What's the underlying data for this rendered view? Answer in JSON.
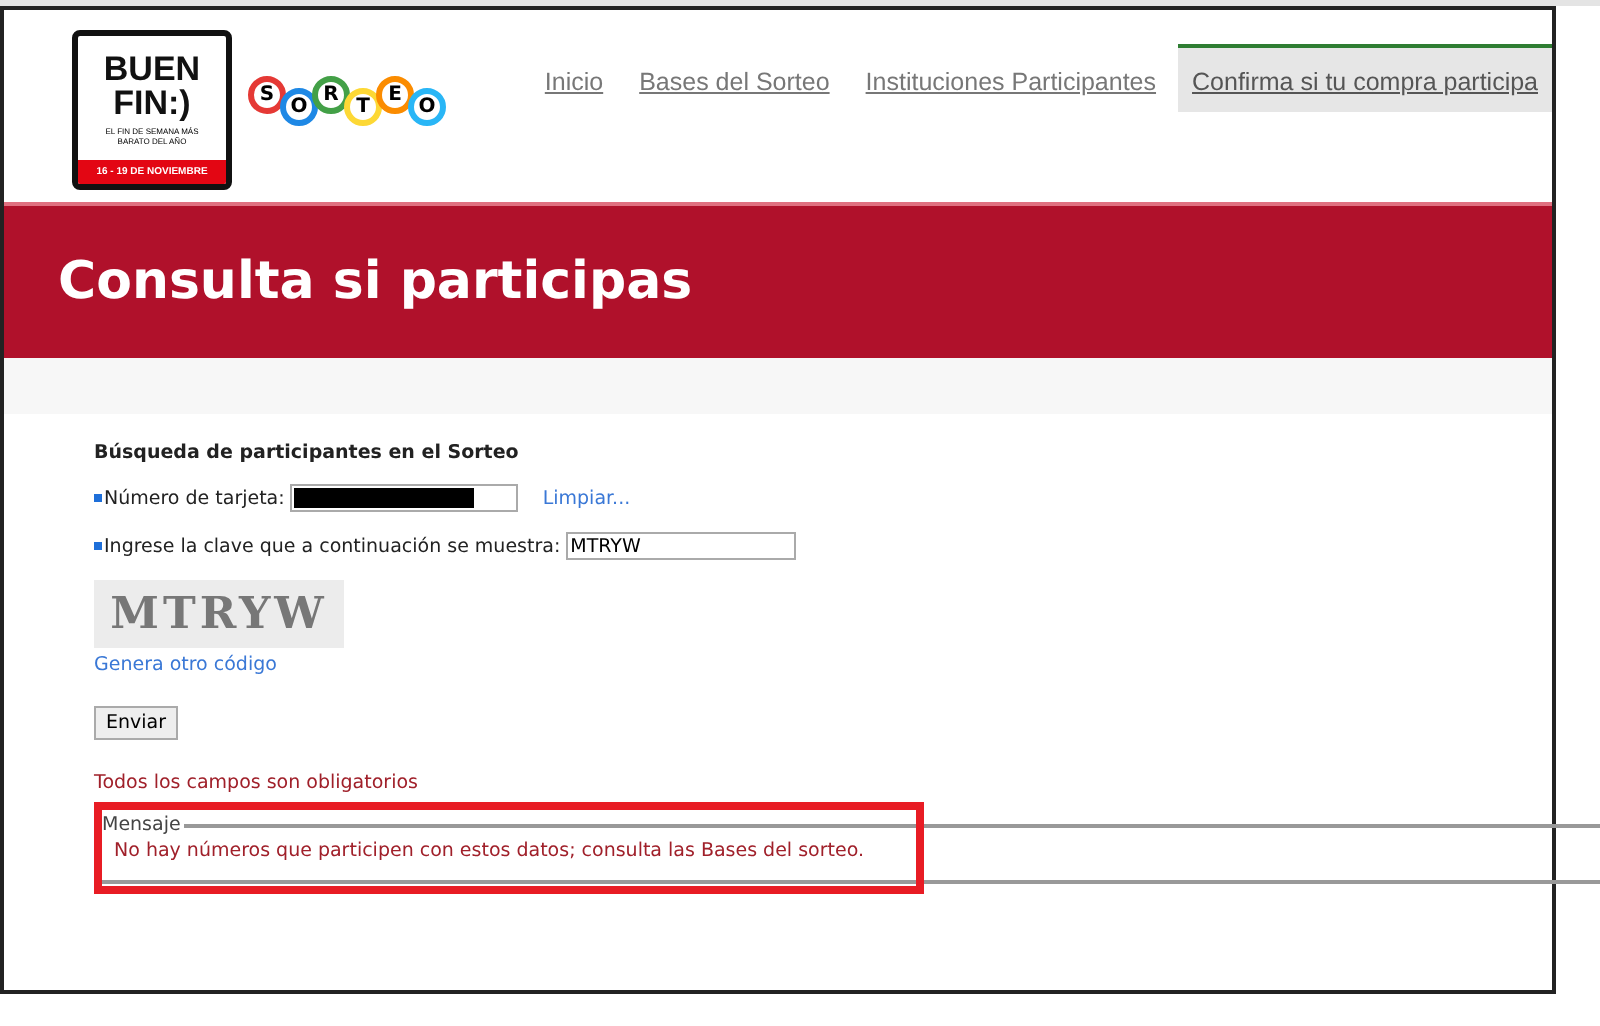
{
  "logo": {
    "title": "BUEN FIN:)",
    "tagline": "EL FIN DE SEMANA MÁS BARATO DEL AÑO",
    "dates": "16 - 19 DE NOVIEMBRE"
  },
  "sorteo_logo": [
    {
      "letter": "S",
      "color": "#e53935"
    },
    {
      "letter": "O",
      "color": "#1e88e5"
    },
    {
      "letter": "R",
      "color": "#43a047"
    },
    {
      "letter": "T",
      "color": "#fdd835"
    },
    {
      "letter": "E",
      "color": "#fb8c00"
    },
    {
      "letter": "O",
      "color": "#29b6f6"
    }
  ],
  "nav": [
    {
      "label": "Inicio",
      "selected": false
    },
    {
      "label": "Bases del Sorteo",
      "selected": false
    },
    {
      "label": "Instituciones Participantes",
      "selected": false
    },
    {
      "label": "Confirma si tu compra participa",
      "selected": true
    }
  ],
  "banner": {
    "title": "Consulta si participas"
  },
  "form": {
    "heading": "Búsqueda de participantes en el Sorteo",
    "card_label": "Número de tarjeta:",
    "card_redacted": true,
    "clear_link": "Limpiar...",
    "code_label": "Ingrese la clave que a continuación se muestra:",
    "code_value": "MTRYW",
    "captcha": "MTRYW",
    "new_code_link": "Genera otro código",
    "submit": "Enviar",
    "required_note": "Todos los campos son obligatorios"
  },
  "message": {
    "legend": "Mensaje",
    "text": "No hay números que participen con estos datos; consulta las Bases del sorteo.",
    "highlighted": true
  }
}
